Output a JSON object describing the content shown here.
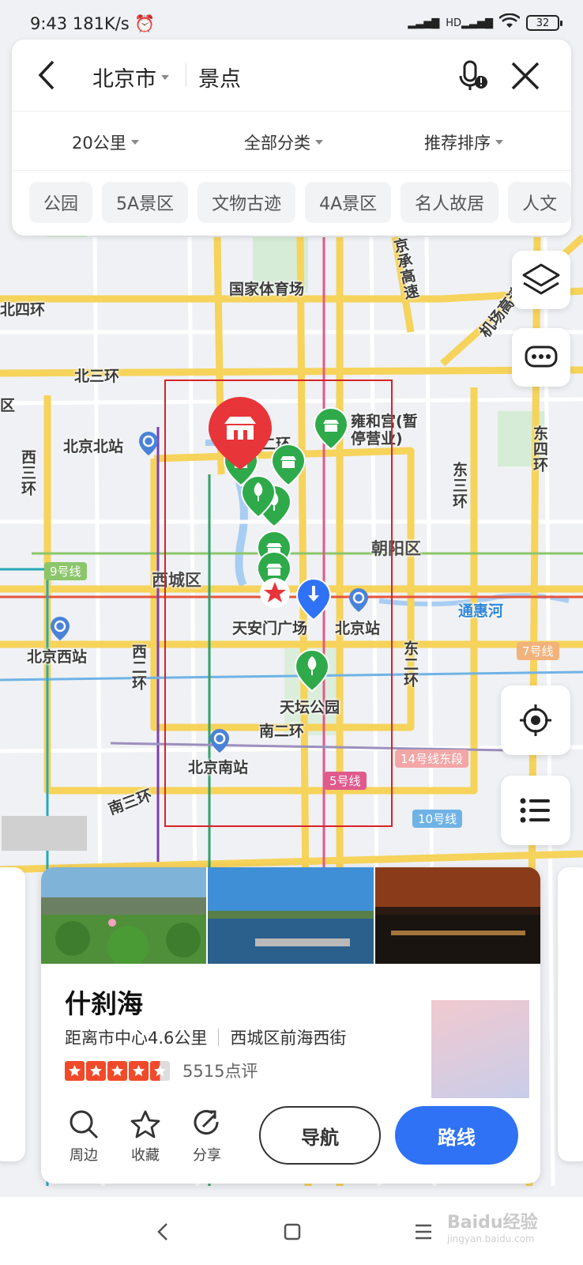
{
  "status_bar": {
    "time": "9:43",
    "speed": "181K/s",
    "network": "HD",
    "battery": "32"
  },
  "search": {
    "city": "北京市",
    "keyword": "景点",
    "filters": [
      "20公里",
      "全部分类",
      "推荐排序"
    ],
    "chips": [
      "公园",
      "5A景区",
      "文物古迹",
      "4A景区",
      "名人故居",
      "人文"
    ]
  },
  "map_labels": {
    "stadium": "国家体育场",
    "north4": "北四环",
    "north3": "北三环",
    "beijing_north": "北京北站",
    "west3": "西三环",
    "district_west": "区",
    "line9": "9号线",
    "xicheng": "西城区",
    "beijing_west": "北京西站",
    "west2": "西二环",
    "ring2": "二环",
    "yonghegong": "雍和宫(暂停营业)",
    "chaoyang": "朝阳区",
    "east3": "东三环",
    "east4": "东四环",
    "tongyu": "通惠河",
    "line7": "7号线",
    "east2": "东二环",
    "tiananmen": "天安门广场",
    "beijing_station": "北京站",
    "tiantan": "天坛公园",
    "south2": "南二环",
    "line14": "14号线东段",
    "beijing_south": "北京南站",
    "line5": "5号线",
    "line10": "10号线",
    "south3": "南三环",
    "airport_expy": "机场高速",
    "jingcheng_expy": "京承高速"
  },
  "poi": {
    "title": "什刹海",
    "distance": "距离市中心4.6公里",
    "address": "西城区前海西街",
    "rating": 4.5,
    "reviews": "5515点评",
    "actions": [
      "周边",
      "收藏",
      "分享"
    ],
    "nav_button": "导航",
    "route_button": "路线"
  },
  "watermark": {
    "brand": "Baidu经验",
    "site": "jingyan.baidu.com"
  },
  "colors": {
    "accent_blue": "#2f72f5",
    "pin_red": "#e8353a",
    "pin_green": "#2eaa4a",
    "selection_box": "#d8232a"
  }
}
